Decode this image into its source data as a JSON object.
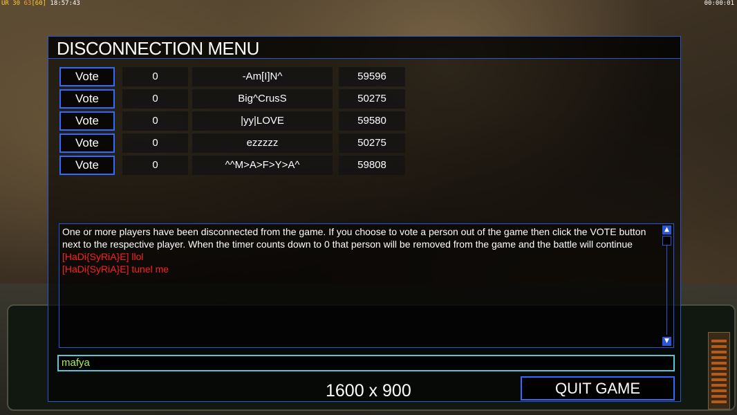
{
  "hud": {
    "ur_label": "UR",
    "fps_a": "30",
    "fps_b": "63",
    "fps_c": "[60]",
    "clock": "18:57:43",
    "timer": "00:00:01"
  },
  "dialog": {
    "title": "DISCONNECTION MENU",
    "players": [
      {
        "vote_label": "Vote",
        "count": "0",
        "name": "-Am[I]N^",
        "ping": "59596"
      },
      {
        "vote_label": "Vote",
        "count": "0",
        "name": "Big^CrusS",
        "ping": "50275"
      },
      {
        "vote_label": "Vote",
        "count": "0",
        "name": "|yy|LOVE",
        "ping": "59580"
      },
      {
        "vote_label": "Vote",
        "count": "0",
        "name": "ezzzzz",
        "ping": "50275"
      },
      {
        "vote_label": "Vote",
        "count": "0",
        "name": "^^M>A>F>Y>A^",
        "ping": "59808"
      }
    ],
    "message": {
      "system_text": "One or more players have been disconnected from the game. If you choose to vote a person out of the game then click the VOTE button next to the respective player. When the timer counts down to 0 that person will be removed from the game and the battle will continue",
      "chat": [
        "[HaDi{SyRiA}E] llol",
        "[HaDi{SyRiA}E] tunel me"
      ]
    },
    "chat_input_value": "mafya",
    "resolution": "1600 x 900",
    "quit_label": "QUIT GAME"
  },
  "colors": {
    "border": "#2a57d6",
    "button_border": "#2f6bff",
    "chat_color": "#ff2020",
    "input_border": "#57c6d8",
    "input_text": "#a8f04c"
  },
  "icons": {
    "scroll_up": "arrow-up-icon",
    "scroll_down": "arrow-down-icon"
  }
}
